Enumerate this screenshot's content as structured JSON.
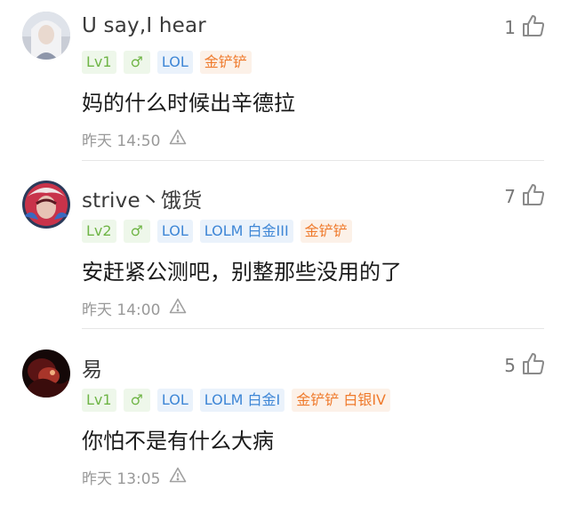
{
  "comments": [
    {
      "username": "U say,I hear",
      "likes": "1",
      "badges": [
        "Lv1",
        "♂",
        "LOL",
        "金铲铲"
      ],
      "text": "妈的什么时候出辛德拉",
      "time": "昨天 14:50"
    },
    {
      "username": "strive丶饿货",
      "likes": "7",
      "badges": [
        "Lv2",
        "♂",
        "LOL",
        "LOLM 白金III",
        "金铲铲"
      ],
      "text": "安赶紧公测吧，别整那些没用的了",
      "time": "昨天 14:00"
    },
    {
      "username": "易",
      "likes": "5",
      "badges": [
        "Lv1",
        "♂",
        "LOL",
        "LOLM 白金I",
        "金铲铲 白银IV"
      ],
      "text": "你怕不是有什么大病",
      "time": "昨天 13:05"
    }
  ],
  "icons": {
    "like": "thumbs-up-icon",
    "report": "warning-triangle-icon"
  },
  "colors": {
    "level": "#6fb546",
    "game": "#3e86d6",
    "tft": "#ef7a2c"
  }
}
